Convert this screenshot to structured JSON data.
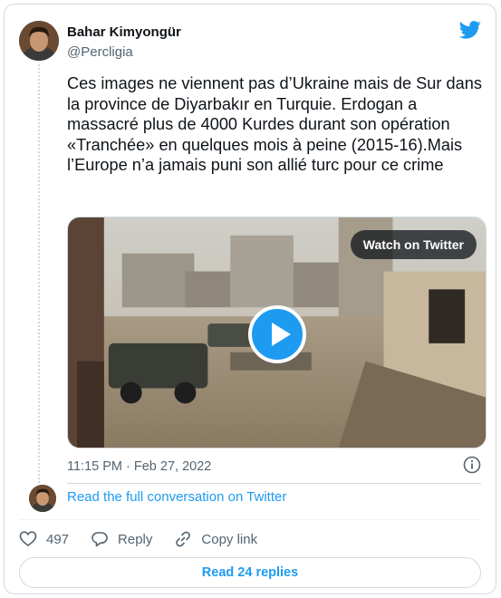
{
  "author": {
    "name": "Bahar Kimyongür",
    "handle": "@Percligia"
  },
  "tweet": {
    "text": "Ces images ne viennent pas d’Ukraine mais de Sur dans la province de Diyarbakır en Turquie. Erdogan a massacré plus de 4000 Kurdes durant son opération «Tranchée» en quelques mois à peine (2015-16).Mais l’Europe n’a jamais puni son allié turc pour ce crime"
  },
  "media": {
    "watch_label": "Watch on Twitter"
  },
  "meta": {
    "timestamp": "11:15 PM · Feb 27, 2022"
  },
  "conversation": {
    "link_label": "Read the full conversation on Twitter"
  },
  "actions": {
    "like_count": "497",
    "reply_label": "Reply",
    "copy_label": "Copy link"
  },
  "footer": {
    "replies_label": "Read 24 replies"
  },
  "colors": {
    "accent": "#1d9bf0",
    "text_primary": "#0f1419",
    "text_secondary": "#536471",
    "border": "#cfd9de"
  }
}
